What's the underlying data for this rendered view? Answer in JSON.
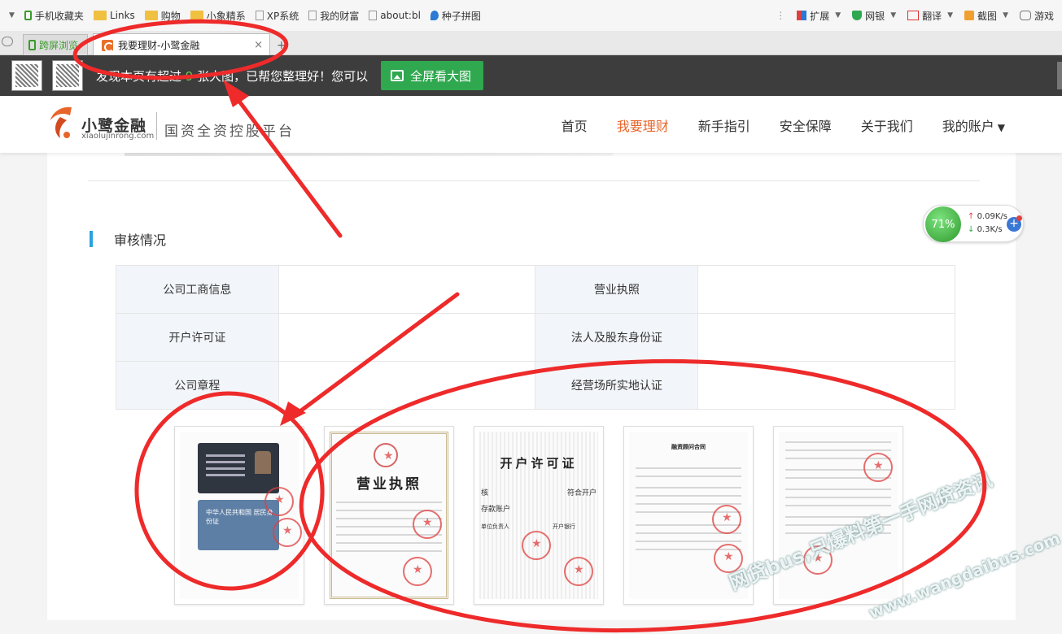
{
  "browser": {
    "bookmarks": [
      "手机收藏夹",
      "Links",
      "购物",
      "小象精系",
      "XP系统",
      "我的财富",
      "about:bl",
      "种子拼图"
    ],
    "toolbar_right": [
      "扩展",
      "网银",
      "翻译",
      "截图",
      "游戏"
    ],
    "tabs": [
      {
        "label": "跨屏浏览"
      },
      {
        "label": "我要理财-小鹭金融"
      }
    ],
    "close_glyph": "×",
    "new_tab_glyph": "+"
  },
  "notice": {
    "prefix": "发现本页有超过",
    "count": "9",
    "suffix": "张大图，已帮您整理好！您可以",
    "button_label": "全屏看大图"
  },
  "site": {
    "logo_name": "小鹭金融",
    "logo_domain": "xiaolujinrong.com",
    "slogan": "国资全资控股平台",
    "nav": [
      {
        "label": "首页"
      },
      {
        "label": "我要理财",
        "active": true
      },
      {
        "label": "新手指引"
      },
      {
        "label": "安全保障"
      },
      {
        "label": "关于我们"
      },
      {
        "label": "我的账户"
      }
    ],
    "accent_color": "#e8652a",
    "section_bar_color": "#2ba2e0"
  },
  "audit": {
    "title": "审核情况",
    "rows": [
      [
        "公司工商信息",
        "营业执照"
      ],
      [
        "开户许可证",
        "法人及股东身份证"
      ],
      [
        "公司章程",
        "经营场所实地认证"
      ]
    ]
  },
  "documents": [
    {
      "kind": "id-card",
      "front_text": "",
      "back_text": "中华人民共和国 居民身份证"
    },
    {
      "kind": "business-license",
      "title": "营业执照"
    },
    {
      "kind": "account-permit",
      "title": "开户许可证",
      "fields": [
        "核",
        "符合开户",
        "存款账户",
        "单位负责人",
        "开户银行"
      ]
    },
    {
      "kind": "contract",
      "title": "融资顾问合同"
    },
    {
      "kind": "contract-page"
    }
  ],
  "carousel": {
    "next_glyph": "›"
  },
  "speed_widget": {
    "percent": "71%",
    "upload": "0.09K/s",
    "download": "0.3K/s",
    "plus": "+"
  },
  "watermark": {
    "line1": "网贷bus,只爆料第一手网贷资讯",
    "line2": "www.wangdaibus.com"
  }
}
